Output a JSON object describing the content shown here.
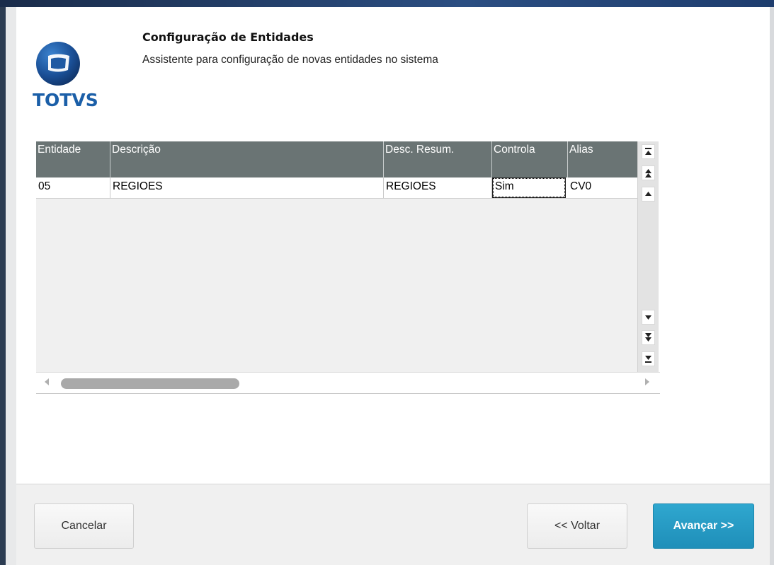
{
  "header": {
    "title": "Configuração de Entidades",
    "subtitle": "Assistente para configuração de novas entidades no sistema",
    "logo_text": "TOTVS"
  },
  "table": {
    "columns": [
      "Entidade",
      "Descrição",
      "Desc. Resum.",
      "Controla",
      "Alias"
    ],
    "rows": [
      [
        "05",
        "REGIOES",
        "REGIOES",
        "Sim",
        "CV0"
      ]
    ]
  },
  "scrollbar": {
    "vertical_buttons": [
      "top-icon",
      "page-up-icon",
      "up-icon",
      "down-icon",
      "page-down-icon",
      "bottom-icon"
    ]
  },
  "footer": {
    "cancel_label": "Cancelar",
    "back_label": "<< Voltar",
    "next_label": "Avançar >>"
  },
  "colors": {
    "header_bg": "#6a7474",
    "primary_button": "#1f8fb9",
    "logo_blue": "#1b5fa8"
  }
}
